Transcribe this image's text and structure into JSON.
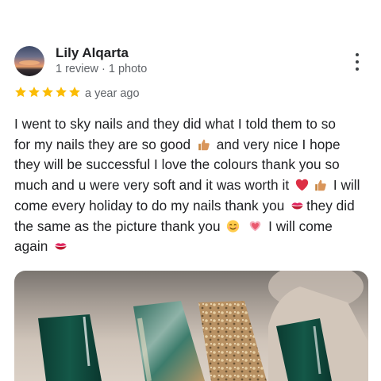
{
  "reviewer": {
    "name": "Lily Alqarta",
    "meta": "1 review · 1 photo"
  },
  "rating": {
    "stars": 5,
    "star_color": "#fbbc04",
    "date": "a year ago"
  },
  "review_text": {
    "segments": [
      "I went to sky nails and they did what I told them to so",
      "for my nails they are so good",
      "and very nice I hope",
      "they will be successful I love the colours thank you so",
      "much and u were very soft and it was worth it",
      "I will",
      "come every holiday to do my nails thank you",
      "they did",
      "the same as the picture thank you",
      "I will come",
      "again"
    ],
    "emoji": [
      "thumbs-up-icon",
      "red-heart-icon",
      "kiss-mark-icon",
      "smiling-face-icon",
      "sparkling-heart-icon"
    ]
  },
  "photo": {
    "subject": "nail-art-photo",
    "nail_colors": [
      "#0f4a3e",
      "#3f7a6c",
      "#c9a77a"
    ]
  },
  "colors": {
    "text": "#202124",
    "secondary_text": "#5f6368"
  }
}
